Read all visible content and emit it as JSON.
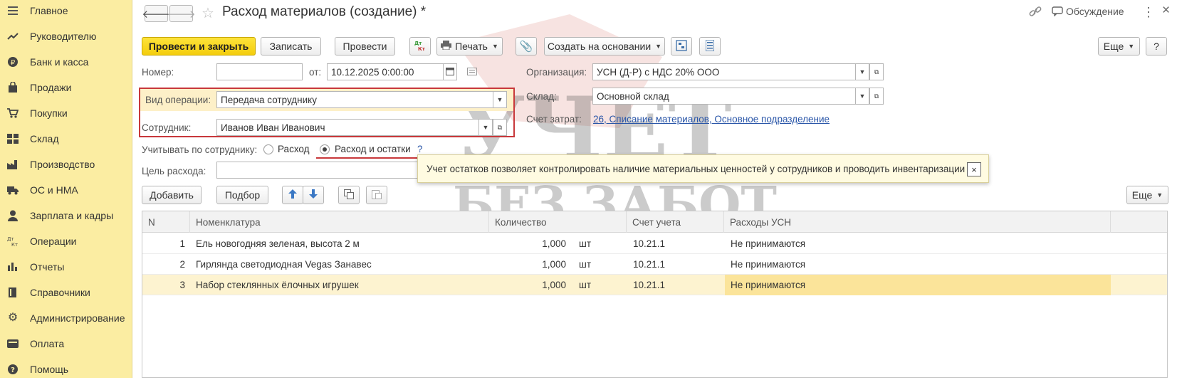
{
  "sidebar": {
    "items": [
      {
        "label": "Главное",
        "icon": "menu-icon"
      },
      {
        "label": "Руководителю",
        "icon": "trend-icon"
      },
      {
        "label": "Банк и касса",
        "icon": "ruble-icon"
      },
      {
        "label": "Продажи",
        "icon": "bag-icon"
      },
      {
        "label": "Покупки",
        "icon": "cart-icon"
      },
      {
        "label": "Склад",
        "icon": "warehouse-icon"
      },
      {
        "label": "Производство",
        "icon": "factory-icon"
      },
      {
        "label": "ОС и НМА",
        "icon": "truck-icon"
      },
      {
        "label": "Зарплата и кадры",
        "icon": "person-icon"
      },
      {
        "label": "Операции",
        "icon": "dt-kt-icon"
      },
      {
        "label": "Отчеты",
        "icon": "bar-chart-icon"
      },
      {
        "label": "Справочники",
        "icon": "book-icon"
      },
      {
        "label": "Администрирование",
        "icon": "gear-icon"
      },
      {
        "label": "Оплата",
        "icon": "payment-icon"
      },
      {
        "label": "Помощь",
        "icon": "help-icon"
      }
    ]
  },
  "header": {
    "title": "Расход материалов (создание) *",
    "discussion": "Обсуждение"
  },
  "toolbar": {
    "post_close": "Провести и закрыть",
    "save": "Записать",
    "post": "Провести",
    "dt_kt": "Дт Кт",
    "print": "Печать",
    "create_based": "Создать на основании",
    "more": "Еще",
    "help": "?"
  },
  "form": {
    "number_label": "Номер:",
    "number_value": "",
    "date_from_label": "от:",
    "date_value": "10.12.2025  0:00:00",
    "org_label": "Организация:",
    "org_value": "УСН (Д-Р) с НДС 20% ООО",
    "op_type_label": "Вид операции:",
    "op_type_value": "Передача сотруднику",
    "warehouse_label": "Склад:",
    "warehouse_value": "Основной склад",
    "employee_label": "Сотрудник:",
    "employee_value": "Иванов Иван Иванович",
    "cost_account_label": "Счет затрат:",
    "cost_account_value": "26, Списание материалов, Основное подразделение",
    "track_label": "Учитывать по сотруднику:",
    "radio_expense": "Расход",
    "radio_expense_balance": "Расход и остатки",
    "radio_help": "?",
    "purpose_label": "Цель расхода:",
    "purpose_value": ""
  },
  "tooltip": {
    "text": "Учет остатков позволяет контролировать наличие материальных ценностей у сотрудников и проводить инвентаризации",
    "close": "×"
  },
  "table_toolbar": {
    "add": "Добавить",
    "pick": "Подбор",
    "more": "Еще"
  },
  "table": {
    "columns": [
      "N",
      "Номенклатура",
      "Количество",
      "Счет учета",
      "Расходы УСН"
    ],
    "rows": [
      {
        "n": "1",
        "name": "Ель новогодняя зеленая, высота 2 м",
        "qty": "1,000",
        "unit": "шт",
        "account": "10.21.1",
        "usn": "Не принимаются"
      },
      {
        "n": "2",
        "name": "Гирлянда светодиодная Vegas Занавес",
        "qty": "1,000",
        "unit": "шт",
        "account": "10.21.1",
        "usn": "Не принимаются"
      },
      {
        "n": "3",
        "name": "Набор стеклянных ёлочных игрушек",
        "qty": "1,000",
        "unit": "шт",
        "account": "10.21.1",
        "usn": "Не принимаются"
      }
    ],
    "selected_row": 3
  },
  "watermark": {
    "line1": "УЧЕТ",
    "line2": "БЕЗ ЗАБОТ"
  }
}
